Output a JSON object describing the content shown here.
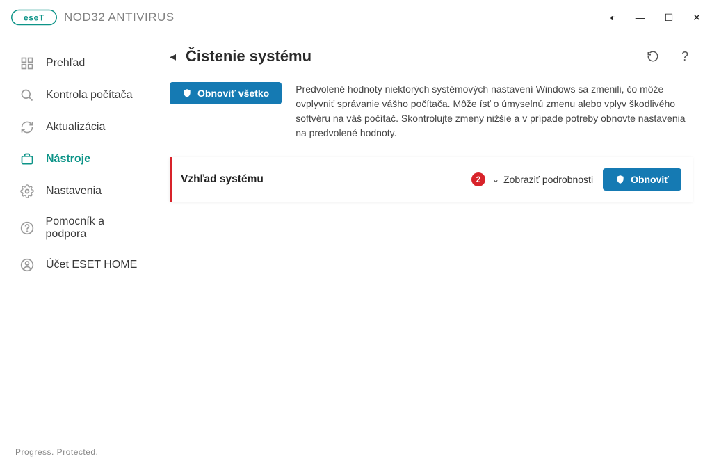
{
  "product": {
    "name": "NOD32 ANTIVIRUS"
  },
  "window_controls": {
    "contrast": "◐",
    "minimize": "—",
    "maximize": "☐",
    "close": "✕"
  },
  "sidebar": {
    "items": [
      {
        "label": "Prehľad"
      },
      {
        "label": "Kontrola počítača"
      },
      {
        "label": "Aktualizácia"
      },
      {
        "label": "Nástroje"
      },
      {
        "label": "Nastavenia"
      },
      {
        "label": "Pomocník a podpora"
      },
      {
        "label": "Účet ESET HOME"
      }
    ]
  },
  "page": {
    "title": "Čistenie systému",
    "reset_all_label": "Obnoviť všetko",
    "intro_text": "Predvolené hodnoty niektorých systémových nastavení Windows sa zmenili, čo môže ovplyvniť správanie vášho počítača. Môže ísť o úmyselnú zmenu alebo vplyv škodlivého softvéru na váš počítač. Skontrolujte zmeny nižšie a v prípade potreby obnovte nastavenia na predvolené hodnoty."
  },
  "card": {
    "title": "Vzhľad systému",
    "badge_count": "2",
    "show_details_label": "Zobraziť podrobnosti",
    "reset_label": "Obnoviť"
  },
  "footer": {
    "text": "Progress. Protected."
  }
}
